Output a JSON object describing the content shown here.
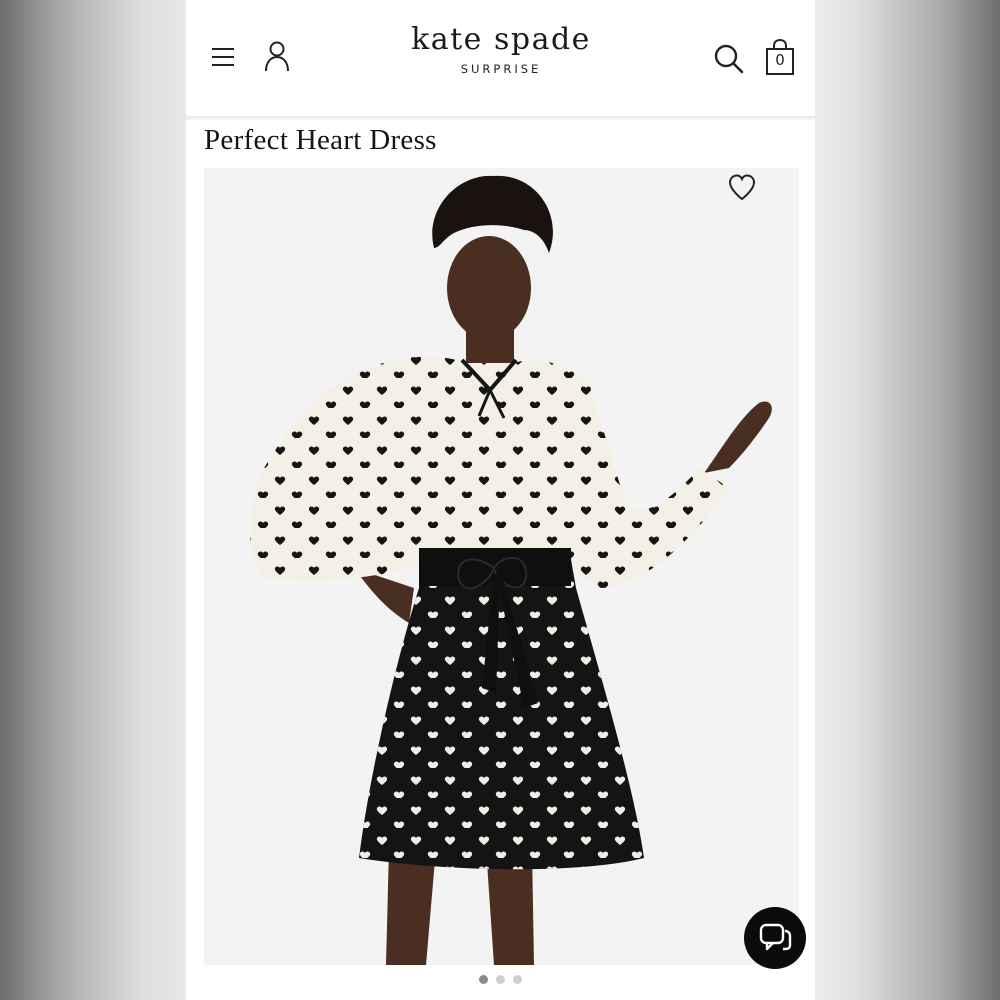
{
  "header": {
    "brand_name": "kate spade",
    "brand_sub": "SURPRISE",
    "bag_count": "0",
    "icons": [
      "menu-icon",
      "account-icon",
      "search-icon",
      "shopping-bag-icon"
    ]
  },
  "product": {
    "title": "Perfect Heart Dress",
    "image_alt": "Model wearing Perfect Heart Dress"
  },
  "gallery": {
    "total_images": 3,
    "active_index": 0
  },
  "colors": {
    "dress_top": "#f4f0e6",
    "dress_skirt": "#141414",
    "chat_button": "#0b0b0b"
  }
}
